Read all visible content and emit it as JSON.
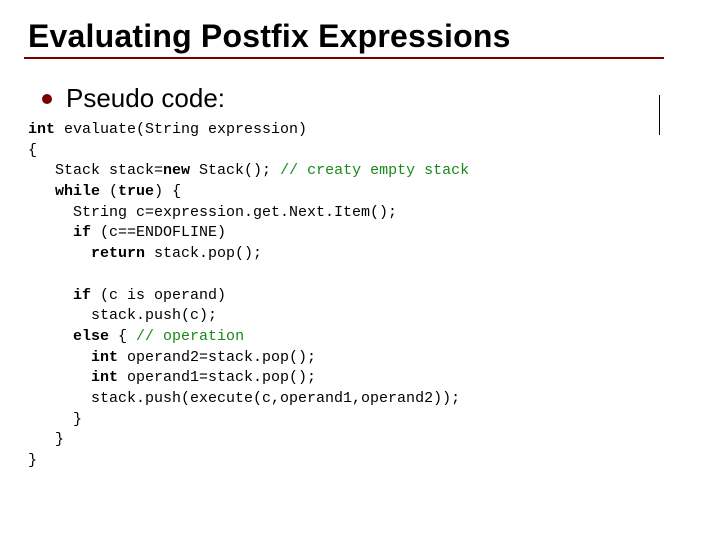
{
  "title": "Evaluating Postfix Expressions",
  "subhead": "Pseudo code:",
  "code": {
    "l1a": "int",
    "l1b": " evaluate(String expression)",
    "l2": "{",
    "l3a": "   Stack stack=",
    "l3b": "new",
    "l3c": " Stack(); ",
    "l3d": "// creaty empty stack",
    "l4a": "   ",
    "l4b": "while",
    "l4c": " (",
    "l4d": "true",
    "l4e": ") {",
    "l5": "     String c=expression.get.Next.Item();",
    "l6a": "     ",
    "l6b": "if",
    "l6c": " (c==ENDOFLINE)",
    "l7a": "       ",
    "l7b": "return",
    "l7c": " stack.pop();",
    "l9a": "     ",
    "l9b": "if",
    "l9c": " (c is operand)",
    "l10": "       stack.push(c);",
    "l11a": "     ",
    "l11b": "else",
    "l11c": " { ",
    "l11d": "// operation",
    "l12a": "       ",
    "l12b": "int",
    "l12c": " operand2=stack.pop();",
    "l13a": "       ",
    "l13b": "int",
    "l13c": " operand1=stack.pop();",
    "l14": "       stack.push(execute(c,operand1,operand2));",
    "l15": "     }",
    "l16": "   }",
    "l17": "}"
  }
}
